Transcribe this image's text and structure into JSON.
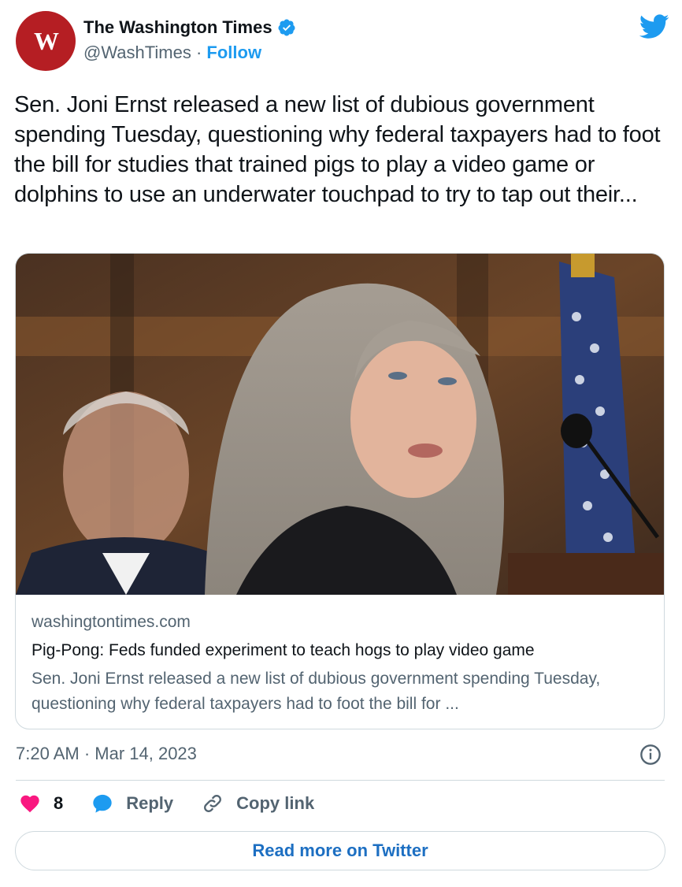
{
  "account": {
    "avatar_text": "W",
    "name": "The Washington Times",
    "handle": "@WashTimes",
    "separator": "·",
    "follow_label": "Follow"
  },
  "tweet": {
    "text": "Sen. Joni Ernst released a new list of dubious government spending Tuesday, questioning why federal taxpayers had to foot the bill for studies that trained pigs to play a video game or dolphins to use an underwater touchpad to try to tap out their...",
    "timestamp": "7:20 AM · Mar 14, 2023"
  },
  "card": {
    "domain": "washingtontimes.com",
    "title": "Pig-Pong: Feds funded experiment to teach hogs to play video game",
    "description": "Sen. Joni Ernst released a new list of dubious government spending Tuesday, questioning why federal taxpayers had to foot the bill for ..."
  },
  "actions": {
    "like_count": "8",
    "reply_label": "Reply",
    "copy_label": "Copy link"
  },
  "read_more_label": "Read more on Twitter",
  "colors": {
    "brand_red": "#b51e23",
    "twitter_blue": "#1d9bf0",
    "like_pink": "#f91880"
  }
}
